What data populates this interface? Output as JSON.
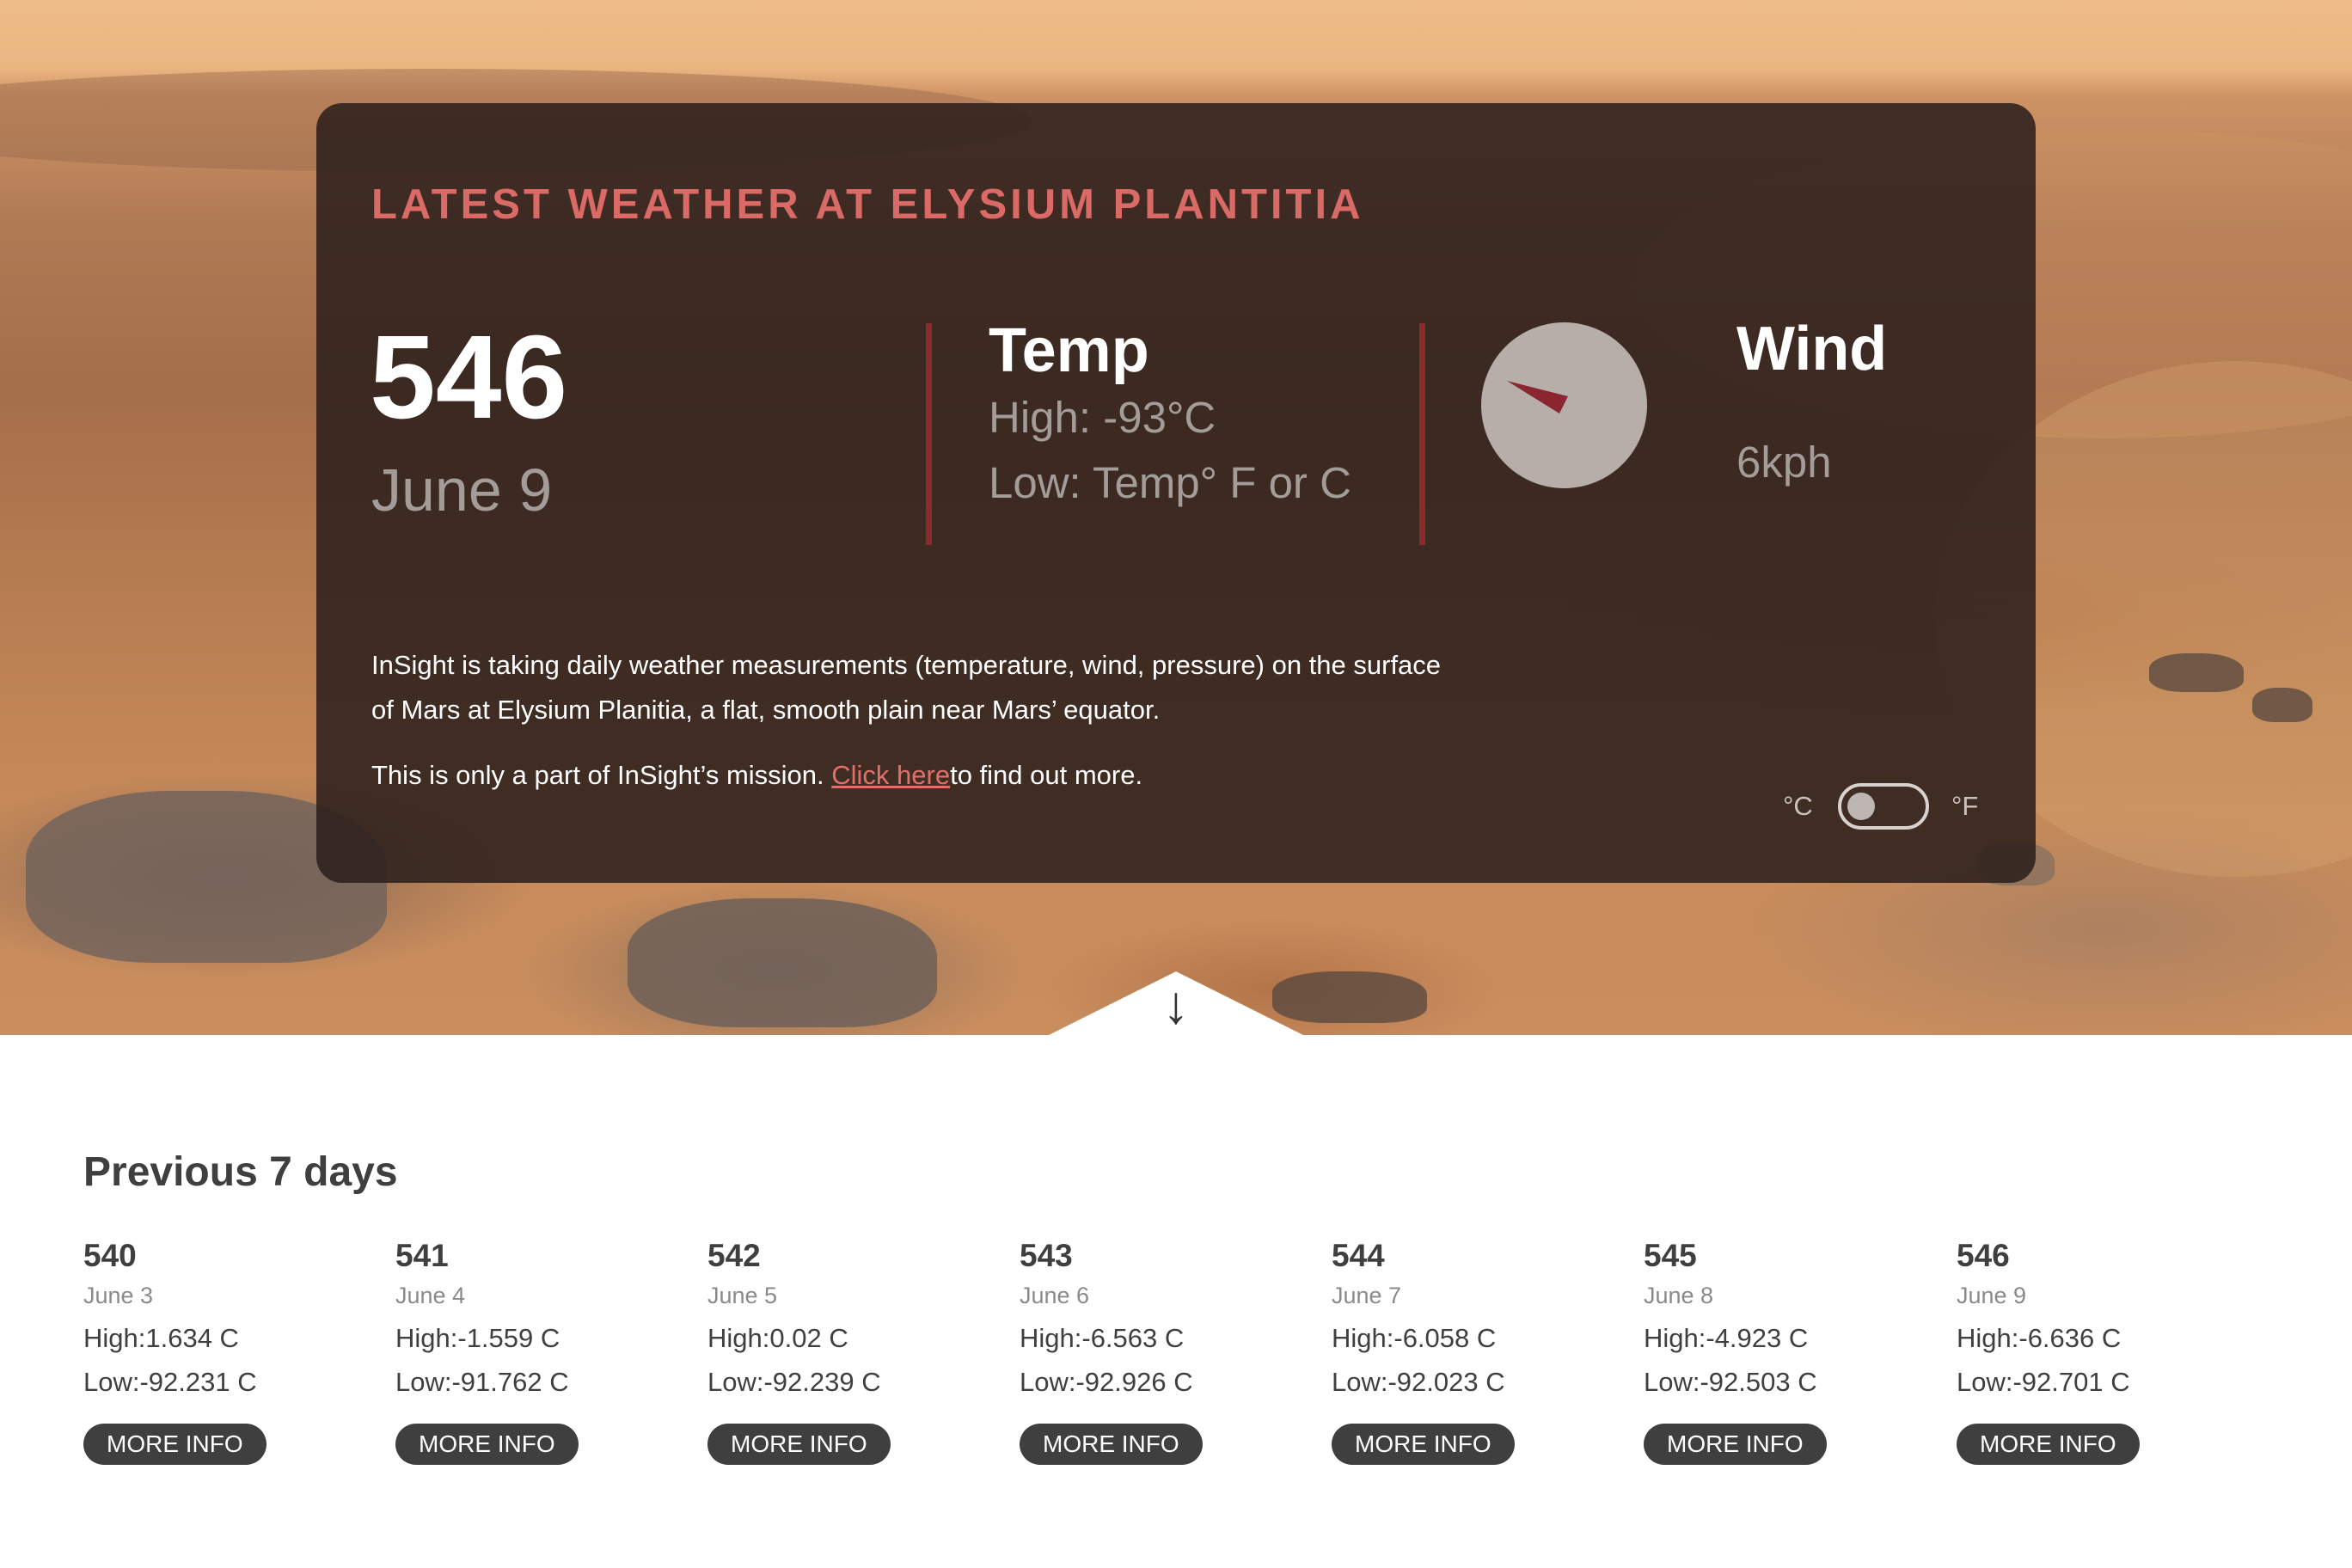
{
  "hero": {
    "title": "Latest Weather at Elysium Plantitia",
    "sol": "546",
    "date": "June 9",
    "temp": {
      "heading": "Temp",
      "high": "High: -93°C",
      "low": "Low: Temp° F or C"
    },
    "wind": {
      "heading": "Wind",
      "speed": "6kph"
    },
    "description": "InSight is taking daily weather measurements (temperature, wind, pressure) on the surface of Mars at Elysium Planitia, a flat, smooth plain near Mars’ equator.",
    "mission_text": "This is only a part of InSight’s mission. ",
    "mission_link": "Click here",
    "mission_suffix": "to find out more.",
    "unit_c": "°C",
    "unit_f": "°F",
    "scroll_arrow": "↓"
  },
  "previous": {
    "title": "Previous 7 days",
    "days": [
      {
        "sol": "540",
        "date": "June 3",
        "high": "High:1.634 C",
        "low": "Low:-92.231 C",
        "button": "MORE INFO"
      },
      {
        "sol": "541",
        "date": "June 4",
        "high": "High:-1.559 C",
        "low": "Low:-91.762 C",
        "button": "MORE INFO"
      },
      {
        "sol": "542",
        "date": "June 5",
        "high": "High:0.02 C",
        "low": "Low:-92.239 C",
        "button": "MORE INFO"
      },
      {
        "sol": "543",
        "date": "June 6",
        "high": "High:-6.563 C",
        "low": "Low:-92.926 C",
        "button": "MORE INFO"
      },
      {
        "sol": "544",
        "date": "June 7",
        "high": "High:-6.058 C",
        "low": "Low:-92.023 C",
        "button": "MORE INFO"
      },
      {
        "sol": "545",
        "date": "June 8",
        "high": "High:-4.923 C",
        "low": "Low:-92.503 C",
        "button": "MORE INFO"
      },
      {
        "sol": "546",
        "date": "June 9",
        "high": "High:-6.636 C",
        "low": "Low:-92.701 C",
        "button": "MORE INFO"
      }
    ]
  },
  "colors": {
    "accent": "#d96a65",
    "divider": "#8a2c2c",
    "needle": "#8b2630",
    "card_bg": "#2c201c",
    "button_bg": "#3f3f3f"
  },
  "icons": {
    "compass": "wind-direction-compass-icon",
    "arrow": "arrow-down-icon"
  }
}
